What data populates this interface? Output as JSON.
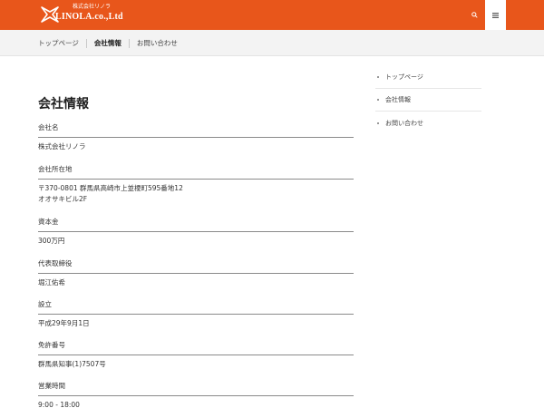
{
  "header": {
    "logo_sub": "株式会社リノラ",
    "logo_main": "LINOLA.co.,Ltd",
    "brand_color": "#e8561b",
    "search_icon": "search-icon",
    "menu_icon": "hamburger-icon"
  },
  "breadcrumb": {
    "items": [
      "トップページ",
      "会社情報",
      "お問い合わせ"
    ]
  },
  "main": {
    "title": "会社情報",
    "rows": [
      {
        "label": "会社名",
        "value": [
          "株式会社リノラ"
        ]
      },
      {
        "label": "会社所在地",
        "value": [
          "〒370-0801 群馬県高崎市上並榎町595番地12",
          "オオサキビル2F"
        ]
      },
      {
        "label": "資本金",
        "value": [
          "300万円"
        ]
      },
      {
        "label": "代表取締役",
        "value": [
          "堀江佑希"
        ]
      },
      {
        "label": "設立",
        "value": [
          "平成29年9月1日"
        ]
      },
      {
        "label": "免許番号",
        "value": [
          "群馬県知事(1)7507号"
        ]
      },
      {
        "label": "営業時間",
        "value": [
          "9:00 - 18:00"
        ]
      }
    ]
  },
  "sidebar": {
    "items": [
      "トップページ",
      "会社情報",
      "お問い合わせ"
    ]
  }
}
